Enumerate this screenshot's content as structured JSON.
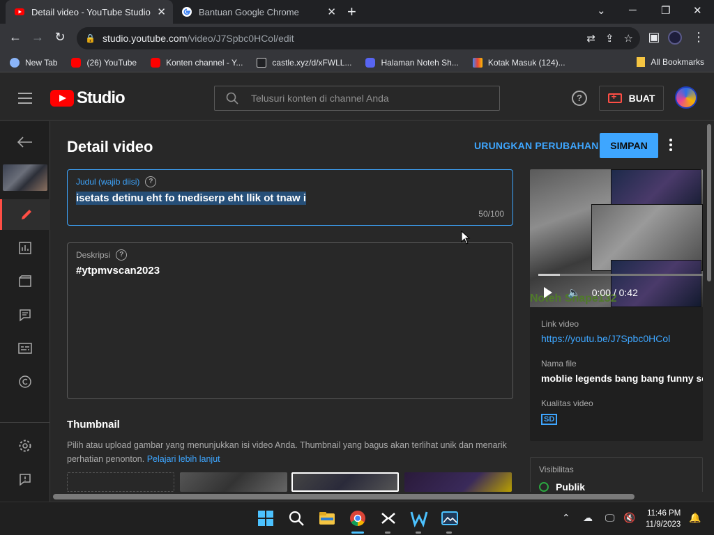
{
  "browser": {
    "tabs": [
      {
        "title": "Detail video - YouTube Studio",
        "active": true
      },
      {
        "title": "Bantuan Google Chrome",
        "active": false
      }
    ],
    "url_host": "studio.youtube.com",
    "url_path": "/video/J7Spbc0HCol/edit",
    "bookmarks": [
      {
        "label": "New Tab",
        "icon": "globe-icon"
      },
      {
        "label": "(26) YouTube",
        "icon": "youtube-icon"
      },
      {
        "label": "Konten channel - Y...",
        "icon": "youtube-icon"
      },
      {
        "label": "castle.xyz/d/xFWLL...",
        "icon": "castle-icon"
      },
      {
        "label": "Halaman Noteh Sh...",
        "icon": "discord-icon"
      },
      {
        "label": "Kotak Masuk (124)...",
        "icon": "gmail-icon"
      }
    ],
    "all_bookmarks": "All Bookmarks"
  },
  "studio": {
    "logo_text": "Studio",
    "search_placeholder": "Telusuri konten di channel Anda",
    "help_label": "?",
    "create_label": "BUAT"
  },
  "page": {
    "title": "Detail video",
    "undo_label": "URUNGKAN PERUBAHAN",
    "save_label": "SIMPAN",
    "title_field": {
      "label": "Judul (wajib diisi)",
      "value": "isetats detinu eht fo tnediserp eht llik ot tnaw i",
      "count": "50/100"
    },
    "desc_field": {
      "label": "Deskripsi",
      "value": "#ytpmvscan2023"
    },
    "thumbnail": {
      "heading": "Thumbnail",
      "description": "Pilih atau upload gambar yang menunjukkan isi video Anda. Thumbnail yang bagus akan terlihat unik dan menarik perhatian penonton.",
      "learn_more": "Pelajari lebih lanjut"
    }
  },
  "video_panel": {
    "watermark": "Noteh Shape132",
    "time": "0:00 / 0:42",
    "progress_fraction": 0.13,
    "link_label": "Link video",
    "link_value": "https://youtu.be/J7Spbc0HCol",
    "filename_label": "Nama file",
    "filename_value": "moblie legends bang bang funny so",
    "quality_label": "Kualitas video",
    "quality_badge": "SD"
  },
  "visibility": {
    "label": "Visibilitas",
    "value": "Publik"
  },
  "taskbar": {
    "time": "11:46 PM",
    "date": "11/9/2023"
  },
  "colors": {
    "accent": "#3ea6ff",
    "youtube_red": "#ff0000",
    "active_nav": "#ff4e45"
  }
}
